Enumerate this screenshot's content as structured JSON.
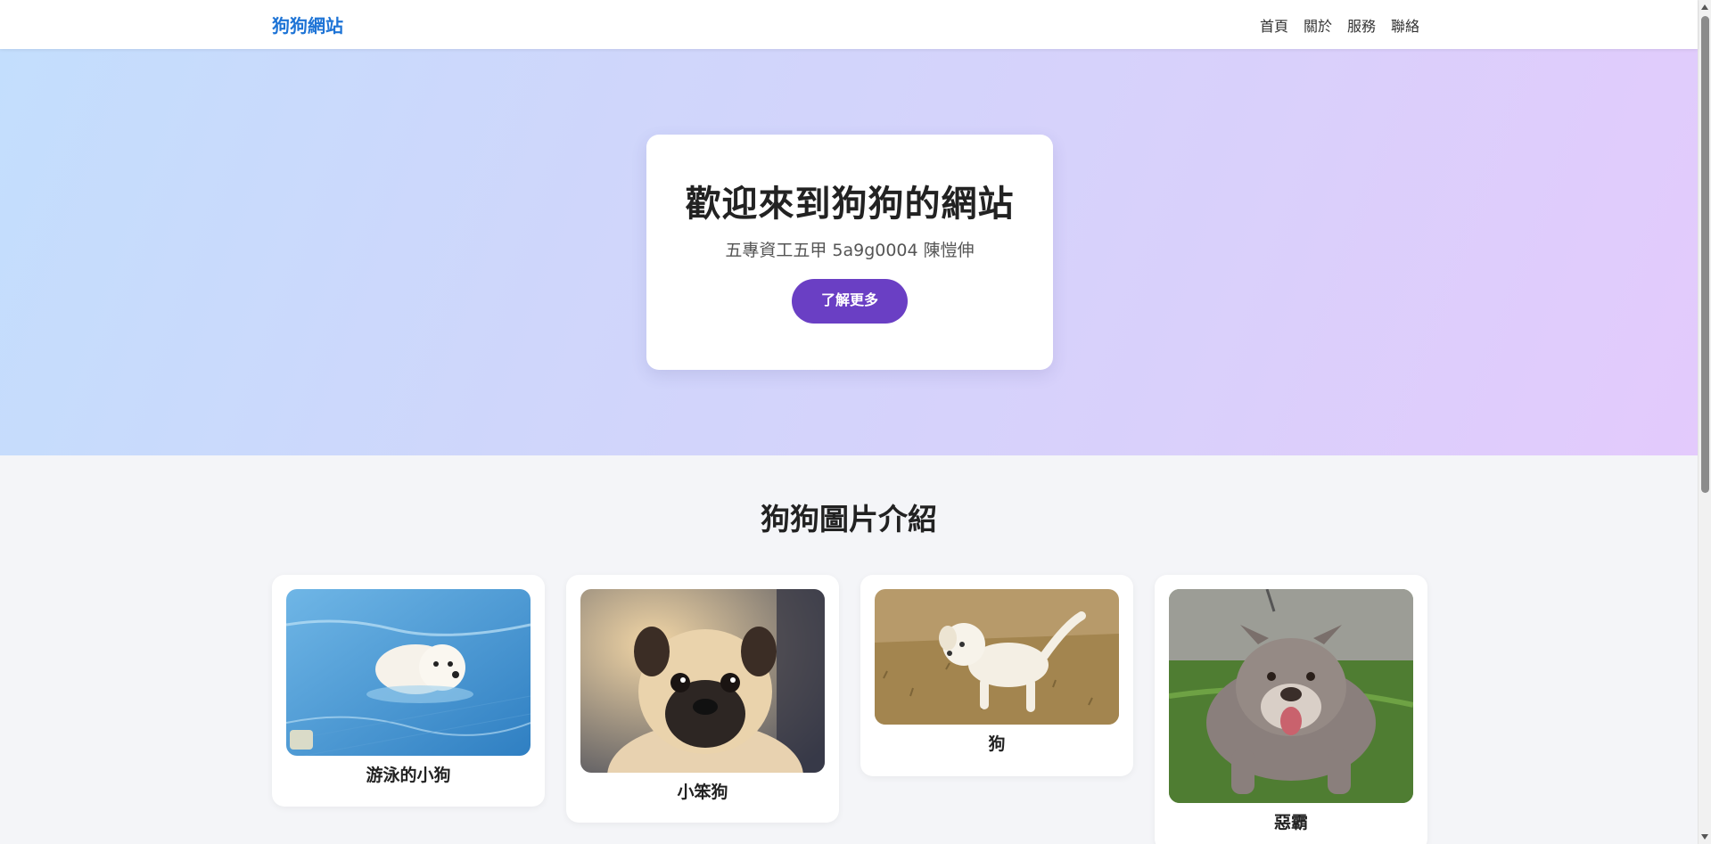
{
  "header": {
    "brand": "狗狗網站",
    "nav": [
      "首頁",
      "關於",
      "服務",
      "聯絡"
    ]
  },
  "hero": {
    "title": "歡迎來到狗狗的網站",
    "subtitle": "五專資工五甲 5a9g0004 陳愷伸",
    "button_label": "了解更多"
  },
  "gallery": {
    "title": "狗狗圖片介紹",
    "cards": [
      {
        "label": "游泳的小狗",
        "icon": "swimming-dog-photo"
      },
      {
        "label": "小笨狗",
        "icon": "pug-photo"
      },
      {
        "label": "狗",
        "icon": "puppy-photo"
      },
      {
        "label": "惡霸",
        "icon": "bully-dog-photo"
      }
    ]
  },
  "colors": {
    "brand": "#1e74d6",
    "button": "#6a3fc4"
  }
}
